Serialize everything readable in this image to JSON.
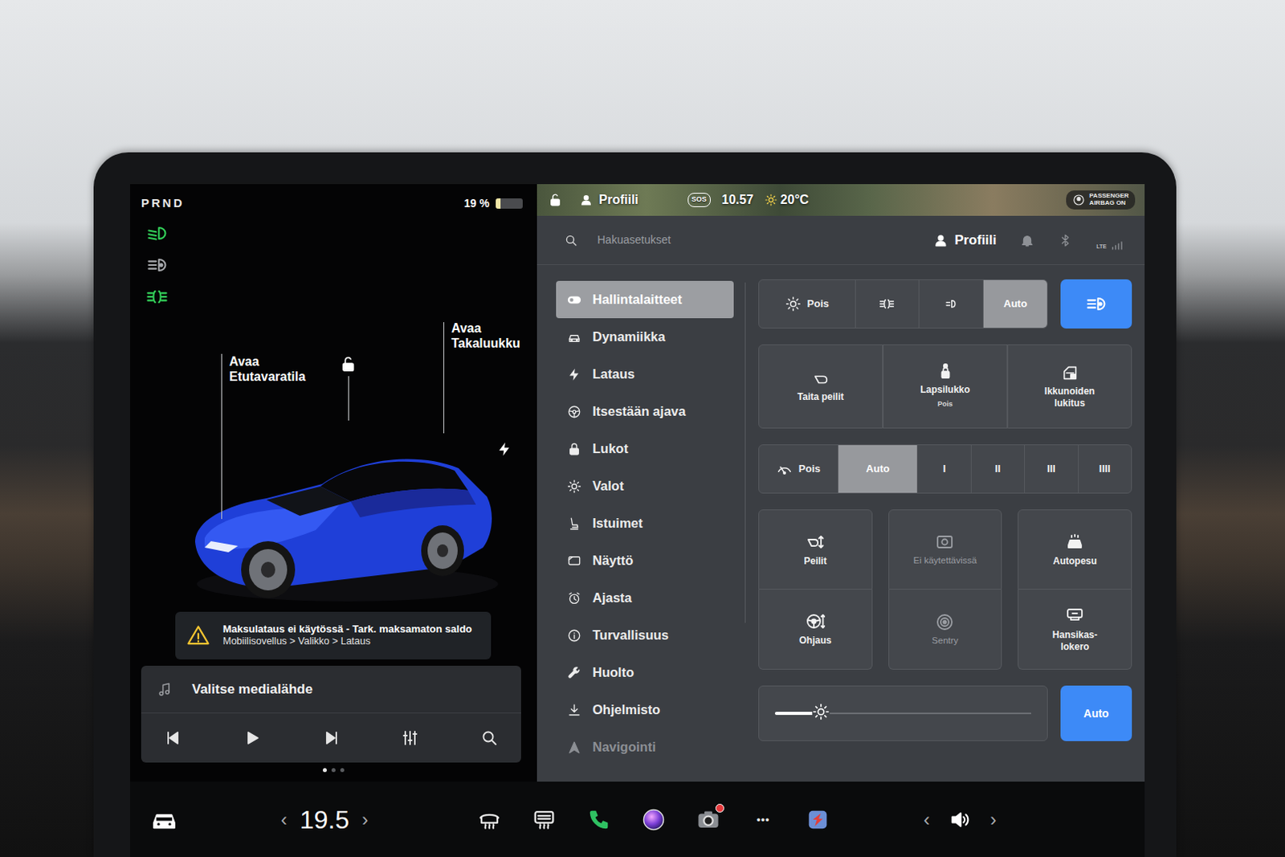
{
  "status": {
    "gear": "PRND",
    "battery": "19 %",
    "battery_level": 0.19
  },
  "indicators": [
    {
      "kind": "low-beam",
      "on": true
    },
    {
      "kind": "auto-high-beam",
      "on": false
    },
    {
      "kind": "fog",
      "on": true
    }
  ],
  "car": {
    "frunk": [
      "Avaa",
      "Etutavaratila"
    ],
    "trunk": [
      "Avaa",
      "Takaluukku"
    ],
    "locked": false
  },
  "alert": {
    "title": "Maksulataus ei käytössä - Tark. maksamaton saldo",
    "path": "Mobiilisovellus > Valikko > Lataus"
  },
  "media": {
    "source": "Valitse medialähde",
    "controls": [
      {
        "kind": "previous"
      },
      {
        "kind": "play"
      },
      {
        "kind": "next"
      },
      {
        "kind": "equalizer"
      },
      {
        "kind": "search"
      }
    ],
    "pages": [
      {
        "selected": true
      },
      {
        "selected": false
      },
      {
        "selected": false
      }
    ]
  },
  "topbar": {
    "locked": false,
    "profile": "Profiili",
    "sos": "SOS",
    "time": "10.57",
    "temperature": "20°C",
    "airbag": [
      "PASSENGER",
      "AIRBAG ON"
    ]
  },
  "search": {
    "placeholder": "Hakuasetukset"
  },
  "header": {
    "profile": "Profiili",
    "network": "LTE"
  },
  "sidebar": {
    "items": [
      {
        "label": "Hallintalaitteet",
        "kind": "toggle",
        "selected": true,
        "dimmed": false
      },
      {
        "label": "Dynamiikka",
        "kind": "car",
        "selected": false,
        "dimmed": false
      },
      {
        "label": "Lataus",
        "kind": "bolt",
        "selected": false,
        "dimmed": false
      },
      {
        "label": "Itsestään ajava",
        "kind": "steering",
        "selected": false,
        "dimmed": false
      },
      {
        "label": "Lukot",
        "kind": "lock",
        "selected": false,
        "dimmed": false
      },
      {
        "label": "Valot",
        "kind": "sun",
        "selected": false,
        "dimmed": false
      },
      {
        "label": "Istuimet",
        "kind": "seat",
        "selected": false,
        "dimmed": false
      },
      {
        "label": "Näyttö",
        "kind": "display",
        "selected": false,
        "dimmed": false
      },
      {
        "label": "Ajasta",
        "kind": "clock",
        "selected": false,
        "dimmed": false
      },
      {
        "label": "Turvallisuus",
        "kind": "info",
        "selected": false,
        "dimmed": false
      },
      {
        "label": "Huolto",
        "kind": "wrench",
        "selected": false,
        "dimmed": false
      },
      {
        "label": "Ohjelmisto",
        "kind": "download",
        "selected": false,
        "dimmed": false
      },
      {
        "label": "Navigointi",
        "kind": "navigation",
        "selected": false,
        "dimmed": true
      }
    ]
  },
  "lights": {
    "modes": [
      {
        "kind": "off",
        "label": "Pois",
        "selected": false
      },
      {
        "kind": "fog",
        "selected": false
      },
      {
        "kind": "parking",
        "selected": false
      },
      {
        "kind": "auto",
        "label": "Auto",
        "selected": true
      }
    ],
    "auto_high_beam": {
      "on": true
    }
  },
  "quick": [
    {
      "kind": "mirror-fold",
      "label": "Taita peilit"
    },
    {
      "kind": "child-lock",
      "label": "Lapsilukko",
      "sub": "Pois"
    },
    {
      "kind": "window-lock",
      "label": "Ikkunoiden lukitus"
    }
  ],
  "wipers": [
    {
      "kind": "off",
      "label": "Pois",
      "selected": false
    },
    {
      "kind": "auto",
      "label": "Auto",
      "selected": true
    },
    {
      "kind": "speed",
      "label": "I",
      "selected": false
    },
    {
      "kind": "speed",
      "label": "II",
      "selected": false
    },
    {
      "kind": "speed",
      "label": "III",
      "selected": false
    },
    {
      "kind": "speed",
      "label": "IIII",
      "selected": false
    }
  ],
  "tiles": [
    {
      "kind": "mirrors",
      "label": "Peilit",
      "disabled": false
    },
    {
      "kind": "camera",
      "label": "Ei käytettävissä",
      "disabled": true
    },
    {
      "kind": "car-wash",
      "label": "Autopesu",
      "disabled": false
    },
    {
      "kind": "steering-adjust",
      "label": "Ohjaus",
      "disabled": false
    },
    {
      "kind": "sentry",
      "label": "Sentry",
      "disabled": true
    },
    {
      "kind": "glovebox",
      "label": "Hansikas-lokero",
      "disabled": false
    }
  ],
  "brightness": {
    "level": 0.18,
    "auto": {
      "label": "Auto",
      "on": true
    }
  },
  "dock": {
    "temp_down": "‹",
    "temperature": "19.5",
    "temp_up": "›",
    "apps": [
      {
        "kind": "defrost-front",
        "badge": false
      },
      {
        "kind": "defrost-rear",
        "badge": false
      },
      {
        "kind": "phone",
        "badge": false
      },
      {
        "kind": "media",
        "badge": false
      },
      {
        "kind": "camera-app",
        "badge": true
      },
      {
        "kind": "more",
        "label": "•••",
        "badge": false
      },
      {
        "kind": "navigation-app",
        "badge": false
      }
    ],
    "volume_down": "‹",
    "volume_up": "›"
  }
}
